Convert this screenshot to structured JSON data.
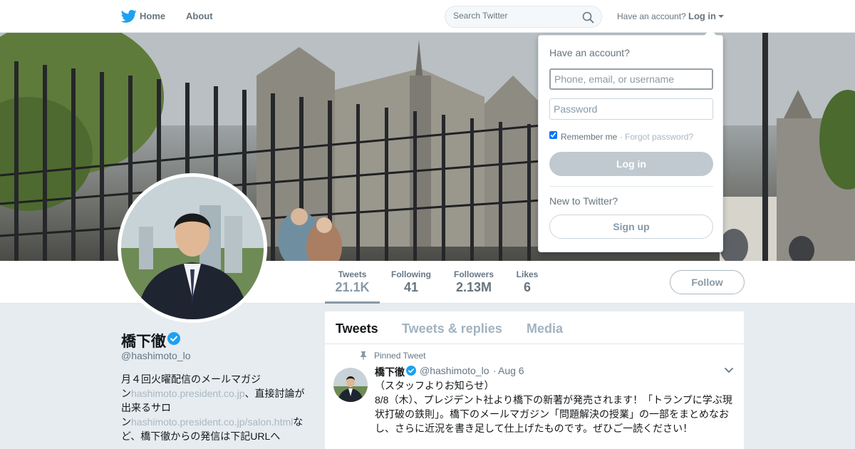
{
  "nav": {
    "home": "Home",
    "about": "About",
    "search_placeholder": "Search Twitter",
    "have_account": "Have an account?",
    "login": "Log in"
  },
  "profile": {
    "name": "橋下徹",
    "handle": "@hashimoto_lo",
    "bio_1": "月４回火曜配信のメールマガジ",
    "bio_2_prefix": "ン",
    "bio_link_1": "hashimoto.president.co.jp",
    "bio_2_suffix": "、直接討論が",
    "bio_3": "出来るサロ",
    "bio_4_prefix": "ン",
    "bio_link_2": "hashimoto.president.co.jp/salon.html",
    "bio_4_suffix": "な",
    "bio_5": "ど、橋下徹からの発信は下記URLへ"
  },
  "stats": [
    {
      "label": "Tweets",
      "value": "21.1K"
    },
    {
      "label": "Following",
      "value": "41"
    },
    {
      "label": "Followers",
      "value": "2.13M"
    },
    {
      "label": "Likes",
      "value": "6"
    }
  ],
  "follow_label": "Follow",
  "tabs": [
    "Tweets",
    "Tweets & replies",
    "Media"
  ],
  "tweet": {
    "pinned_label": "Pinned Tweet",
    "name": "橋下徹",
    "handle": "@hashimoto_lo",
    "dot": "·",
    "date": "Aug 6",
    "text_1": "（スタッフよりお知らせ）",
    "text_2": "8/8（木）、プレジデント社より橋下の新著が発売されます！「トランプに学ぶ現状打破の鉄則」。橋下のメールマガジン「問題解決の授業」の一部をまとめなおし、さらに近況を書き足して仕上げたものです。ぜひご一読ください！"
  },
  "login_dropdown": {
    "title": "Have an account?",
    "username_placeholder": "Phone, email, or username",
    "password_placeholder": "Password",
    "remember": "Remember me",
    "separator": "·",
    "forgot": "Forgot password?",
    "login_button": "Log in",
    "new_to": "New to Twitter?",
    "signup_button": "Sign up"
  },
  "colors": {
    "twitter_blue": "#1da1f2",
    "verified": "#1da1f2"
  }
}
